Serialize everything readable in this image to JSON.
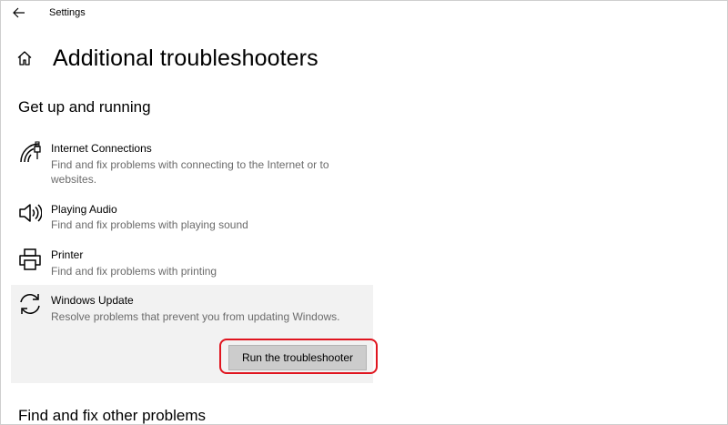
{
  "window": {
    "title": "Settings",
    "back_icon": "back-arrow-icon"
  },
  "page": {
    "title": "Additional troubleshooters",
    "home_icon": "home-icon"
  },
  "sections": {
    "get_up": "Get up and running",
    "find_fix": "Find and fix other problems"
  },
  "items": [
    {
      "icon": "wifi-icon",
      "title": "Internet Connections",
      "description": "Find and fix problems with connecting to the Internet or to websites."
    },
    {
      "icon": "speaker-icon",
      "title": "Playing Audio",
      "description": "Find and fix problems with playing sound"
    },
    {
      "icon": "printer-icon",
      "title": "Printer",
      "description": "Find and fix problems with printing"
    },
    {
      "icon": "refresh-icon",
      "title": "Windows Update",
      "description": "Resolve problems that prevent you from updating Windows.",
      "selected": true
    }
  ],
  "actions": {
    "run_label": "Run the troubleshooter",
    "highlight_color": "#e0151f"
  },
  "colors": {
    "selected_bg": "#f2f2f2",
    "description_text": "#6b6b6b",
    "button_bg": "#cccccc"
  }
}
